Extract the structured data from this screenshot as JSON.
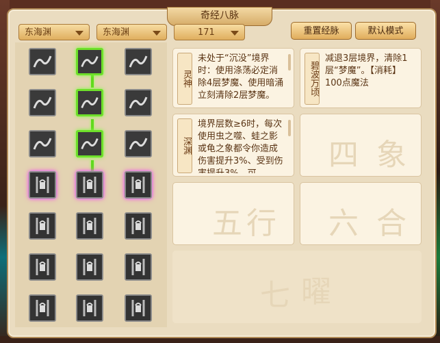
{
  "window": {
    "title": "奇经八脉"
  },
  "dropdowns": [
    {
      "value": "东海渊"
    },
    {
      "value": "东海渊"
    },
    {
      "value": "171"
    }
  ],
  "buttons": {
    "reset": "重置经脉",
    "default_mode": "默认模式"
  },
  "tree": {
    "columns": [
      {
        "nodes": [
          "wave-swirl-icon",
          "fist-strike-icon",
          "lotus-icon",
          "locked-chain-icon",
          "locked-chain-icon",
          "locked-chain-icon",
          "locked-chain-icon"
        ]
      },
      {
        "nodes": [
          "figure-meditate-icon",
          "water-wave-icon",
          "pillar-gate-icon",
          "locked-chain-icon",
          "locked-chain-icon",
          "locked-chain-icon",
          "locked-chain-icon"
        ]
      },
      {
        "nodes": [
          "wind-swirl-icon",
          "mantis-claw-icon",
          "gourd-bag-icon",
          "locked-chain-icon",
          "locked-chain-icon",
          "locked-chain-icon",
          "locked-chain-icon"
        ]
      }
    ]
  },
  "cards": [
    {
      "label": "灵神",
      "text": "未处于“沉没”境界时：使用涤荡必定消除4层梦魔、使用暗涌立刻清除2层梦魔。"
    },
    {
      "label": "碧波万顷",
      "text": "减退3层境界，清除1层“梦魔”。【消耗】100点魔法"
    },
    {
      "label": "深渊",
      "text": "境界层数≥6时，每次使用虫之噬、蛙之影或龟之象都令你造成伤害提升3%、受到伤害提升3%，可"
    }
  ],
  "watermarks": [
    "四",
    "象",
    "五",
    "行",
    "六",
    "合",
    "七",
    "曜"
  ]
}
